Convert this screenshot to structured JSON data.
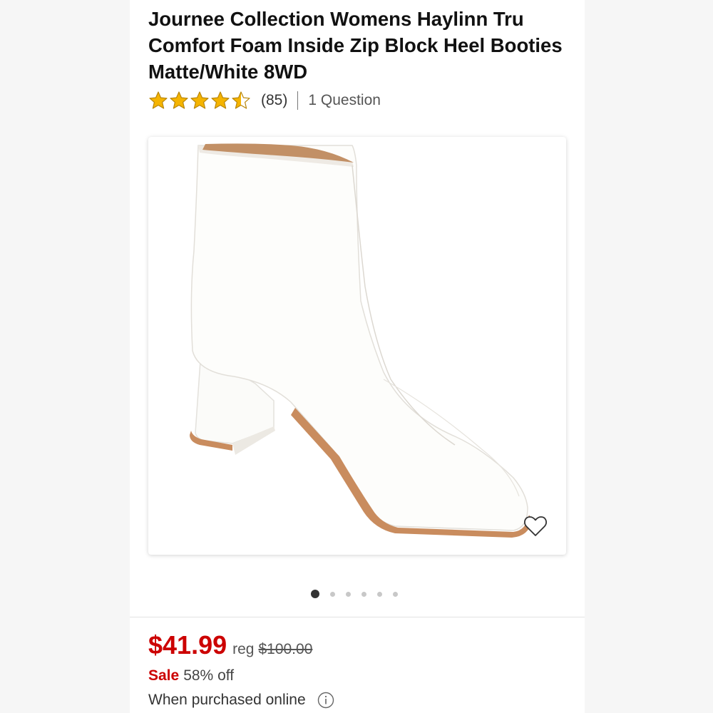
{
  "product": {
    "title": "Journee Collection Womens Haylinn Tru Comfort Foam Inside Zip Block Heel Booties Matte/White 8WD",
    "rating": 4.5,
    "rating_max": 5,
    "review_count": "(85)",
    "questions": "1 Question",
    "image_carousel": {
      "total": 6,
      "active_index": 0
    },
    "price": "$41.99",
    "reg_label": "reg",
    "reg_price": "$100.00",
    "sale_label": "Sale",
    "discount": "58% off",
    "purchase_note": "When purchased online"
  },
  "icons": {
    "rating": "star-icon",
    "favorite": "heart-outline-icon",
    "info": "info-circle-icon"
  },
  "colors": {
    "accent_red": "#cc0000",
    "star_gold": "#f5b400",
    "star_outline": "#b8860b"
  }
}
